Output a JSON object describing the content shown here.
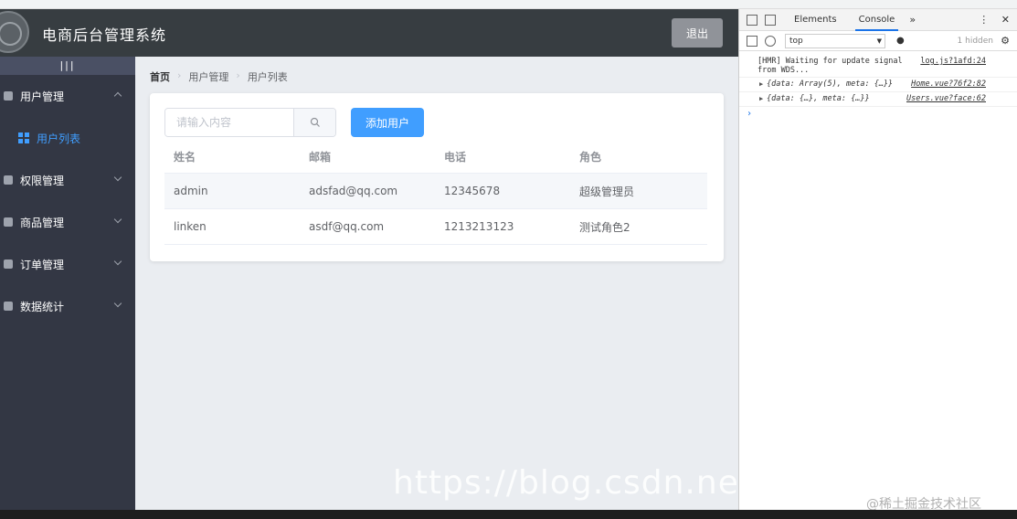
{
  "app": {
    "title": "电商后台管理系统",
    "logout_label": "退出"
  },
  "sidebar": {
    "toggle_label": "|||",
    "menus": [
      {
        "label": "用户管理"
      },
      {
        "label": "权限管理"
      },
      {
        "label": "商品管理"
      },
      {
        "label": "订单管理"
      },
      {
        "label": "数据统计"
      }
    ],
    "active_sub_label": "用户列表"
  },
  "breadcrumb": [
    "首页",
    "用户管理",
    "用户列表"
  ],
  "search": {
    "placeholder": "请输入内容",
    "value": ""
  },
  "add_user_label": "添加用户",
  "table": {
    "headers": [
      "姓名",
      "邮箱",
      "电话",
      "角色"
    ],
    "rows": [
      [
        "admin",
        "adsfad@qq.com",
        "12345678",
        "超级管理员"
      ],
      [
        "linken",
        "asdf@qq.com",
        "1213213123",
        "测试角色2"
      ]
    ]
  },
  "devtools": {
    "tabs": [
      "Elements",
      "Console"
    ],
    "active_tab": "Console",
    "more": "»",
    "context": "top",
    "hidden_count": "1 hidden",
    "logs": [
      {
        "text": "[HMR] Waiting for update signal from WDS...",
        "source": "log.js?1afd:24"
      },
      {
        "text": "{data: Array(5), meta: {…}}",
        "source": "Home.vue?76f2:82"
      },
      {
        "text": "{data: {…}, meta: {…}}",
        "source": "Users.vue?face:62"
      }
    ],
    "prompt": "›"
  },
  "watermark": "https://blog.csdn.net/w",
  "credit": "@稀土掘金技术社区"
}
